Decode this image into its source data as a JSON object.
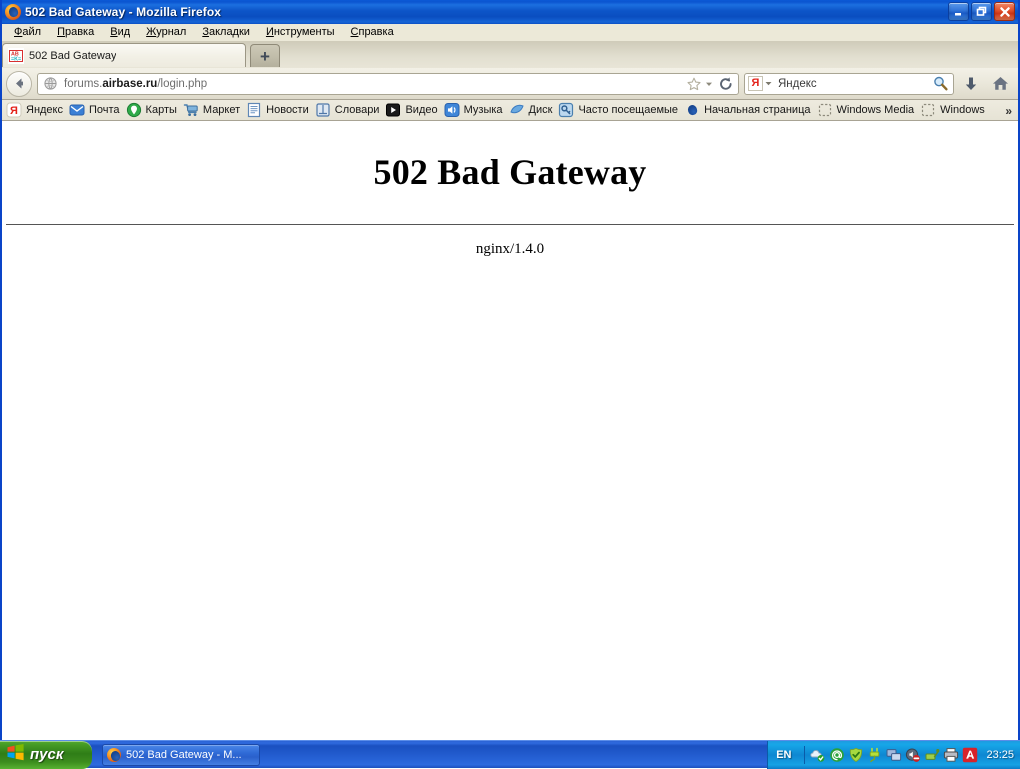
{
  "window": {
    "title": "502 Bad Gateway - Mozilla Firefox",
    "icon": "firefox-icon",
    "minimize_label": "Minimize",
    "restore_label": "Restore",
    "close_label": "Close"
  },
  "menubar": {
    "items": [
      {
        "accel": "Ф",
        "rest": "айл"
      },
      {
        "accel": "П",
        "rest": "равка"
      },
      {
        "accel": "В",
        "rest": "ид"
      },
      {
        "accel": "Ж",
        "rest": "урнал"
      },
      {
        "accel": "З",
        "rest": "акладки"
      },
      {
        "accel": "И",
        "rest": "нструменты"
      },
      {
        "accel": "С",
        "rest": "правка"
      }
    ]
  },
  "tabs": {
    "items": [
      {
        "title": "502 Bad Gateway",
        "favicon": "generic-page-icon",
        "active": true
      }
    ],
    "new_tab_label": "+"
  },
  "navbar": {
    "back_label": "Back",
    "url_prefix": "forums.",
    "url_domain": "airbase.ru",
    "url_suffix": "/login.php",
    "url_full": "forums.airbase.ru/login.php",
    "bookmark_label": "Bookmark this page",
    "reload_label": "Reload",
    "downloads_label": "Downloads",
    "home_label": "Home"
  },
  "search": {
    "engine": "Яндекс",
    "engine_letter": "Я",
    "placeholder": "Яндекс",
    "value": "",
    "go_label": "Search"
  },
  "bookmarks": {
    "items": [
      {
        "label": "Яндекс",
        "icon": "yandex-icon"
      },
      {
        "label": "Почта",
        "icon": "mail-icon"
      },
      {
        "label": "Карты",
        "icon": "maps-icon"
      },
      {
        "label": "Маркет",
        "icon": "cart-icon"
      },
      {
        "label": "Новости",
        "icon": "news-icon"
      },
      {
        "label": "Словари",
        "icon": "dictionary-icon"
      },
      {
        "label": "Видео",
        "icon": "video-play-icon"
      },
      {
        "label": "Музыка",
        "icon": "music-speaker-icon"
      },
      {
        "label": "Диск",
        "icon": "disk-icon"
      },
      {
        "label": "Часто посещаемые",
        "icon": "key-icon"
      },
      {
        "label": "Начальная страница",
        "icon": "firefox-icon"
      },
      {
        "label": "Windows Media",
        "icon": "placeholder-folder-icon"
      },
      {
        "label": "Windows",
        "icon": "placeholder-folder-icon"
      }
    ],
    "overflow_label": "»"
  },
  "page": {
    "heading": "502 Bad Gateway",
    "server": "nginx/1.4.0"
  },
  "taskbar": {
    "start_label": "пуск",
    "items": [
      {
        "label": "502 Bad Gateway - M...",
        "icon": "firefox-icon"
      }
    ],
    "language": "EN",
    "clock": "23:25",
    "tray_icons": [
      "cloud-sync-icon",
      "at-sign-icon",
      "shield-check-icon",
      "power-plug-icon",
      "network-icon",
      "volume-muted-icon",
      "usb-eject-icon",
      "printer-icon",
      "avira-umbrella-icon"
    ]
  },
  "colors": {
    "titlebar_blue": "#0b55d0",
    "taskbar_blue": "#235dd0",
    "start_green": "#2f7d17",
    "chrome_beige": "#ece9d8",
    "accent_red": "#e4231c",
    "page_white": "#ffffff"
  }
}
